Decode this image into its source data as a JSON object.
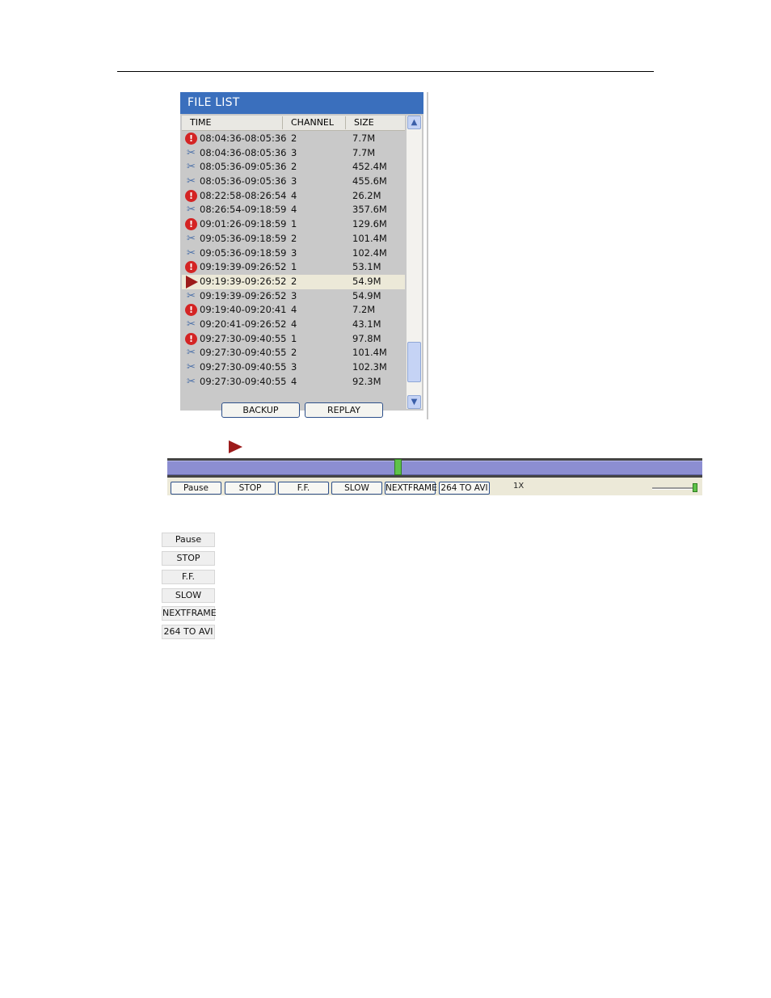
{
  "panel": {
    "title": "FILE LIST",
    "columns": {
      "time": "TIME",
      "channel": "CHANNEL",
      "size": "SIZE"
    },
    "rows": [
      {
        "icon": "alert",
        "time": "08:04:36-08:05:36",
        "channel": "2",
        "size": "7.7M"
      },
      {
        "icon": "clip",
        "time": "08:04:36-08:05:36",
        "channel": "3",
        "size": "7.7M"
      },
      {
        "icon": "clip",
        "time": "08:05:36-09:05:36",
        "channel": "2",
        "size": "452.4M"
      },
      {
        "icon": "clip",
        "time": "08:05:36-09:05:36",
        "channel": "3",
        "size": "455.6M"
      },
      {
        "icon": "alert",
        "time": "08:22:58-08:26:54",
        "channel": "4",
        "size": "26.2M"
      },
      {
        "icon": "clip",
        "time": "08:26:54-09:18:59",
        "channel": "4",
        "size": "357.6M"
      },
      {
        "icon": "alert",
        "time": "09:01:26-09:18:59",
        "channel": "1",
        "size": "129.6M"
      },
      {
        "icon": "clip",
        "time": "09:05:36-09:18:59",
        "channel": "2",
        "size": "101.4M"
      },
      {
        "icon": "clip",
        "time": "09:05:36-09:18:59",
        "channel": "3",
        "size": "102.4M"
      },
      {
        "icon": "alert",
        "time": "09:19:39-09:26:52",
        "channel": "1",
        "size": "53.1M"
      },
      {
        "icon": "play",
        "time": "09:19:39-09:26:52",
        "channel": "2",
        "size": "54.9M",
        "selected": true
      },
      {
        "icon": "clip",
        "time": "09:19:39-09:26:52",
        "channel": "3",
        "size": "54.9M"
      },
      {
        "icon": "alert",
        "time": "09:19:40-09:20:41",
        "channel": "4",
        "size": "7.2M"
      },
      {
        "icon": "clip",
        "time": "09:20:41-09:26:52",
        "channel": "4",
        "size": "43.1M"
      },
      {
        "icon": "alert",
        "time": "09:27:30-09:40:55",
        "channel": "1",
        "size": "97.8M"
      },
      {
        "icon": "clip",
        "time": "09:27:30-09:40:55",
        "channel": "2",
        "size": "101.4M"
      },
      {
        "icon": "clip",
        "time": "09:27:30-09:40:55",
        "channel": "3",
        "size": "102.3M"
      },
      {
        "icon": "clip",
        "time": "09:27:30-09:40:55",
        "channel": "4",
        "size": "92.3M"
      }
    ],
    "backup_label": "BACKUP",
    "replay_label": "REPLAY"
  },
  "player": {
    "buttons": [
      "Pause",
      "STOP",
      "F.F.",
      "SLOW",
      "NEXTFRAME",
      "264 TO AVI"
    ],
    "speed": "1X"
  },
  "legend": {
    "buttons": [
      "Pause",
      "STOP",
      "F.F.",
      "SLOW",
      "NEXTFRAME",
      "264 TO AVI"
    ]
  },
  "colors": {
    "title_bar": "#3a6fbd",
    "alert": "#d42424",
    "play_marker": "#9c1b1b",
    "timeline": "#8c8ed2",
    "slider": "#5fc24a"
  }
}
